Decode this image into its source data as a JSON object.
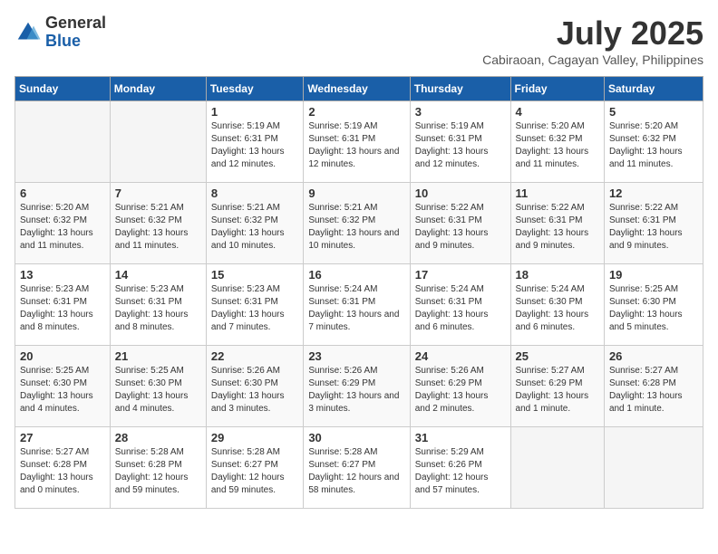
{
  "header": {
    "logo_general": "General",
    "logo_blue": "Blue",
    "month_title": "July 2025",
    "subtitle": "Cabiraoan, Cagayan Valley, Philippines"
  },
  "days_of_week": [
    "Sunday",
    "Monday",
    "Tuesday",
    "Wednesday",
    "Thursday",
    "Friday",
    "Saturday"
  ],
  "weeks": [
    [
      {
        "day": "",
        "info": ""
      },
      {
        "day": "",
        "info": ""
      },
      {
        "day": "1",
        "info": "Sunrise: 5:19 AM\nSunset: 6:31 PM\nDaylight: 13 hours and 12 minutes."
      },
      {
        "day": "2",
        "info": "Sunrise: 5:19 AM\nSunset: 6:31 PM\nDaylight: 13 hours and 12 minutes."
      },
      {
        "day": "3",
        "info": "Sunrise: 5:19 AM\nSunset: 6:31 PM\nDaylight: 13 hours and 12 minutes."
      },
      {
        "day": "4",
        "info": "Sunrise: 5:20 AM\nSunset: 6:32 PM\nDaylight: 13 hours and 11 minutes."
      },
      {
        "day": "5",
        "info": "Sunrise: 5:20 AM\nSunset: 6:32 PM\nDaylight: 13 hours and 11 minutes."
      }
    ],
    [
      {
        "day": "6",
        "info": "Sunrise: 5:20 AM\nSunset: 6:32 PM\nDaylight: 13 hours and 11 minutes."
      },
      {
        "day": "7",
        "info": "Sunrise: 5:21 AM\nSunset: 6:32 PM\nDaylight: 13 hours and 11 minutes."
      },
      {
        "day": "8",
        "info": "Sunrise: 5:21 AM\nSunset: 6:32 PM\nDaylight: 13 hours and 10 minutes."
      },
      {
        "day": "9",
        "info": "Sunrise: 5:21 AM\nSunset: 6:32 PM\nDaylight: 13 hours and 10 minutes."
      },
      {
        "day": "10",
        "info": "Sunrise: 5:22 AM\nSunset: 6:31 PM\nDaylight: 13 hours and 9 minutes."
      },
      {
        "day": "11",
        "info": "Sunrise: 5:22 AM\nSunset: 6:31 PM\nDaylight: 13 hours and 9 minutes."
      },
      {
        "day": "12",
        "info": "Sunrise: 5:22 AM\nSunset: 6:31 PM\nDaylight: 13 hours and 9 minutes."
      }
    ],
    [
      {
        "day": "13",
        "info": "Sunrise: 5:23 AM\nSunset: 6:31 PM\nDaylight: 13 hours and 8 minutes."
      },
      {
        "day": "14",
        "info": "Sunrise: 5:23 AM\nSunset: 6:31 PM\nDaylight: 13 hours and 8 minutes."
      },
      {
        "day": "15",
        "info": "Sunrise: 5:23 AM\nSunset: 6:31 PM\nDaylight: 13 hours and 7 minutes."
      },
      {
        "day": "16",
        "info": "Sunrise: 5:24 AM\nSunset: 6:31 PM\nDaylight: 13 hours and 7 minutes."
      },
      {
        "day": "17",
        "info": "Sunrise: 5:24 AM\nSunset: 6:31 PM\nDaylight: 13 hours and 6 minutes."
      },
      {
        "day": "18",
        "info": "Sunrise: 5:24 AM\nSunset: 6:30 PM\nDaylight: 13 hours and 6 minutes."
      },
      {
        "day": "19",
        "info": "Sunrise: 5:25 AM\nSunset: 6:30 PM\nDaylight: 13 hours and 5 minutes."
      }
    ],
    [
      {
        "day": "20",
        "info": "Sunrise: 5:25 AM\nSunset: 6:30 PM\nDaylight: 13 hours and 4 minutes."
      },
      {
        "day": "21",
        "info": "Sunrise: 5:25 AM\nSunset: 6:30 PM\nDaylight: 13 hours and 4 minutes."
      },
      {
        "day": "22",
        "info": "Sunrise: 5:26 AM\nSunset: 6:30 PM\nDaylight: 13 hours and 3 minutes."
      },
      {
        "day": "23",
        "info": "Sunrise: 5:26 AM\nSunset: 6:29 PM\nDaylight: 13 hours and 3 minutes."
      },
      {
        "day": "24",
        "info": "Sunrise: 5:26 AM\nSunset: 6:29 PM\nDaylight: 13 hours and 2 minutes."
      },
      {
        "day": "25",
        "info": "Sunrise: 5:27 AM\nSunset: 6:29 PM\nDaylight: 13 hours and 1 minute."
      },
      {
        "day": "26",
        "info": "Sunrise: 5:27 AM\nSunset: 6:28 PM\nDaylight: 13 hours and 1 minute."
      }
    ],
    [
      {
        "day": "27",
        "info": "Sunrise: 5:27 AM\nSunset: 6:28 PM\nDaylight: 13 hours and 0 minutes."
      },
      {
        "day": "28",
        "info": "Sunrise: 5:28 AM\nSunset: 6:28 PM\nDaylight: 12 hours and 59 minutes."
      },
      {
        "day": "29",
        "info": "Sunrise: 5:28 AM\nSunset: 6:27 PM\nDaylight: 12 hours and 59 minutes."
      },
      {
        "day": "30",
        "info": "Sunrise: 5:28 AM\nSunset: 6:27 PM\nDaylight: 12 hours and 58 minutes."
      },
      {
        "day": "31",
        "info": "Sunrise: 5:29 AM\nSunset: 6:26 PM\nDaylight: 12 hours and 57 minutes."
      },
      {
        "day": "",
        "info": ""
      },
      {
        "day": "",
        "info": ""
      }
    ]
  ]
}
